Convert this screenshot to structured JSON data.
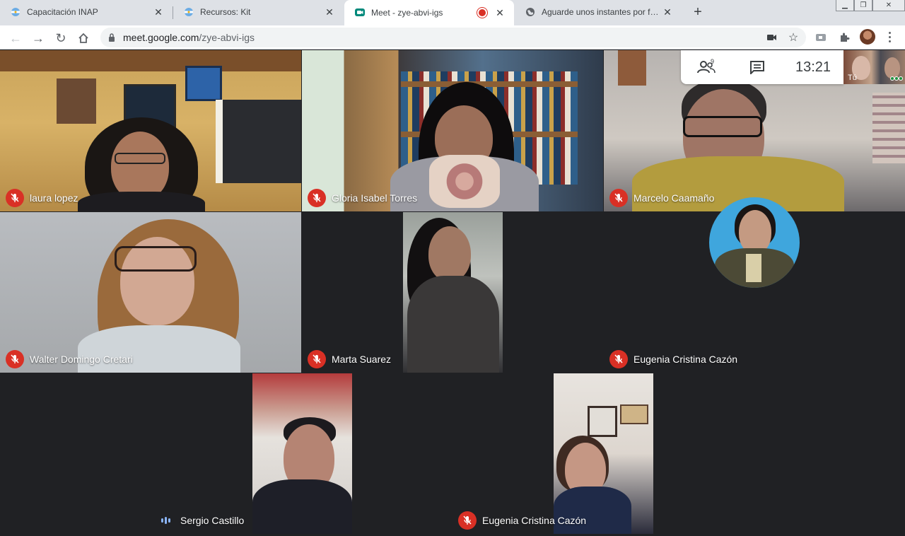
{
  "browser": {
    "tabs": [
      {
        "title": "Capacitación INAP",
        "favicon": "argentina-seal-icon"
      },
      {
        "title": "Recursos: Kit",
        "favicon": "argentina-seal-icon"
      },
      {
        "title": "Meet - zye-abvi-igs",
        "favicon": "meet-icon",
        "active": true,
        "recording": true
      },
      {
        "title": "Aguarde unos instantes por favor...",
        "favicon": "globe-icon"
      }
    ],
    "url_host": "meet.google.com",
    "url_path": "/zye-abvi-igs"
  },
  "meet": {
    "participant_count": "9",
    "time": "13:21",
    "self_label": "Tú",
    "participants": [
      {
        "name": "laura lopez",
        "muted": true
      },
      {
        "name": "Gloria Isabel Torres",
        "muted": true
      },
      {
        "name": "Marcelo Caamaño",
        "muted": true
      },
      {
        "name": "Walter Domingo Cretari",
        "muted": true
      },
      {
        "name": "Marta Suarez",
        "muted": true
      },
      {
        "name": "Eugenia Cristina Cazón",
        "muted": true
      },
      {
        "name": "Sergio Castillo",
        "muted": false,
        "speaking": true
      },
      {
        "name": "Eugenia Cristina Cazón",
        "muted": true
      }
    ]
  },
  "colors": {
    "meet_bg": "#202124",
    "mute_red": "#d93025",
    "tab_bar": "#dee1e6"
  }
}
